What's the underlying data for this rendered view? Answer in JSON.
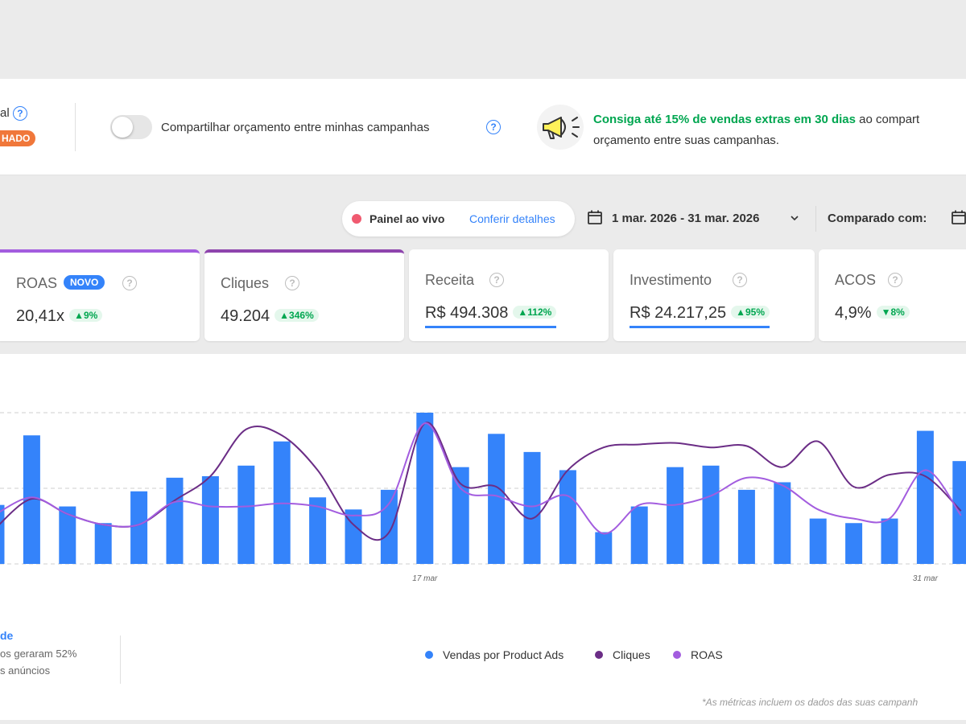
{
  "budget": {
    "cut_label": "al",
    "status_badge": "HADO",
    "share_toggle_label": "Compartilhar orçamento entre minhas campanhas",
    "share_toggle_on": false,
    "promo_highlight": "Consiga até 15% de vendas extras em 30 dias",
    "promo_rest": " ao compart",
    "promo_line2": "orçamento entre suas campanhas."
  },
  "toolbar": {
    "live_label": "Painel ao vivo",
    "live_link": "Conferir detalhes",
    "date_range": "1 mar. 2026 - 31 mar. 2026",
    "compare_label": "Comparado com:"
  },
  "kpis": [
    {
      "label": "ROAS",
      "badge": "NOVO",
      "value": "20,41x",
      "delta": "▲9%"
    },
    {
      "label": "Cliques",
      "value": "49.204",
      "delta": "▲346%"
    },
    {
      "label": "Receita",
      "value": "R$ 494.308",
      "delta": "▲112%"
    },
    {
      "label": "Investimento",
      "value": "R$ 24.217,25",
      "delta": "▲95%"
    },
    {
      "label": "ACOS",
      "value": "4,9%",
      "delta": "▼8%"
    }
  ],
  "help_glyph": "?",
  "chart_data": {
    "type": "bar",
    "x_ticks": [
      "17 mar",
      "31 mar"
    ],
    "series": [
      {
        "name": "Vendas por Product Ads",
        "kind": "bar",
        "color": "#3483fa",
        "values": [
          0.39,
          0.85,
          0.38,
          0.27,
          0.48,
          0.57,
          0.58,
          0.65,
          0.81,
          0.44,
          0.36,
          0.49,
          1.0,
          0.64,
          0.86,
          0.74,
          0.62,
          0.21,
          0.38,
          0.64,
          0.65,
          0.49,
          0.54,
          0.3,
          0.27,
          0.3,
          0.88,
          0.68
        ]
      },
      {
        "name": "Cliques",
        "kind": "line",
        "color": "#6b2d86",
        "values": [
          0.24,
          0.43,
          0.33,
          0.26,
          0.26,
          0.42,
          0.58,
          0.89,
          0.85,
          0.62,
          0.26,
          0.21,
          0.93,
          0.53,
          0.51,
          0.3,
          0.62,
          0.77,
          0.79,
          0.8,
          0.77,
          0.78,
          0.64,
          0.81,
          0.51,
          0.59,
          0.58,
          0.35
        ]
      },
      {
        "name": "ROAS",
        "kind": "line",
        "color": "#a35ddf",
        "values": [
          0.33,
          0.44,
          0.33,
          0.26,
          0.26,
          0.41,
          0.38,
          0.38,
          0.4,
          0.38,
          0.32,
          0.4,
          0.93,
          0.5,
          0.45,
          0.38,
          0.45,
          0.2,
          0.39,
          0.39,
          0.45,
          0.57,
          0.52,
          0.36,
          0.3,
          0.3,
          0.62,
          0.32
        ]
      }
    ]
  },
  "legend": {
    "left_title": "de",
    "left_text_1": "os geraram 52%",
    "left_text_2": "s anúncios",
    "footnote": "*As métricas incluem os dados das suas campanh"
  }
}
